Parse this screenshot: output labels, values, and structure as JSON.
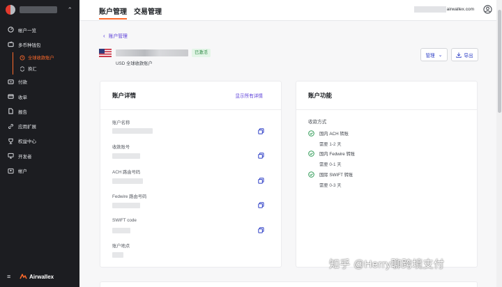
{
  "sidebar": {
    "items": [
      {
        "label": "帐户一览",
        "icon": "dashboard-icon"
      },
      {
        "label": "多币种钱包",
        "icon": "wallet-icon"
      }
    ],
    "sub_items": [
      {
        "label": "全球收款账户",
        "icon": "globe-icon",
        "active": true
      },
      {
        "label": "换汇",
        "icon": "exchange-icon",
        "active": false
      }
    ],
    "items_after": [
      {
        "label": "付款",
        "icon": "payment-icon"
      },
      {
        "label": "收单",
        "icon": "card-icon"
      },
      {
        "label": "报告",
        "icon": "report-icon"
      },
      {
        "label": "应用扩展",
        "icon": "link-icon"
      },
      {
        "label": "权益中心",
        "icon": "trophy-icon"
      },
      {
        "label": "开发者",
        "icon": "monitor-icon"
      },
      {
        "label": "帐户",
        "icon": "account-icon"
      }
    ],
    "brand": "Airwallex",
    "accent_color": "#ff6a2b"
  },
  "header": {
    "tabs": [
      {
        "label": "账户管理",
        "active": true
      },
      {
        "label": "交易管理",
        "active": false
      }
    ],
    "email_suffix": "airwallex.com"
  },
  "page": {
    "back_label": "账户管理",
    "status_badge": "已激活",
    "account_subtitle": "USD 全球收款账户",
    "manage_label": "管理",
    "export_label": "导出"
  },
  "details_card": {
    "title": "账户详情",
    "show_all_label": "显示所有详情",
    "fields": [
      {
        "label": "账户名称"
      },
      {
        "label": "收款账号"
      },
      {
        "label": "ACH 路由号码"
      },
      {
        "label": "Fedwire 路由号码"
      },
      {
        "label": "SWIFT code"
      },
      {
        "label": "账户地点"
      }
    ]
  },
  "features_card": {
    "title": "账户功能",
    "methods_label": "收款方式",
    "methods": [
      {
        "title": "国内 ACH 转账",
        "duration": "需要 1-2 天"
      },
      {
        "title": "国内 Fedwire 转账",
        "duration": "需要 0-1 天"
      },
      {
        "title": "国际 SWIFT 转账",
        "duration": "需要 0-3 天"
      }
    ]
  },
  "watermark": "知乎 @Herry聊跨境支付"
}
